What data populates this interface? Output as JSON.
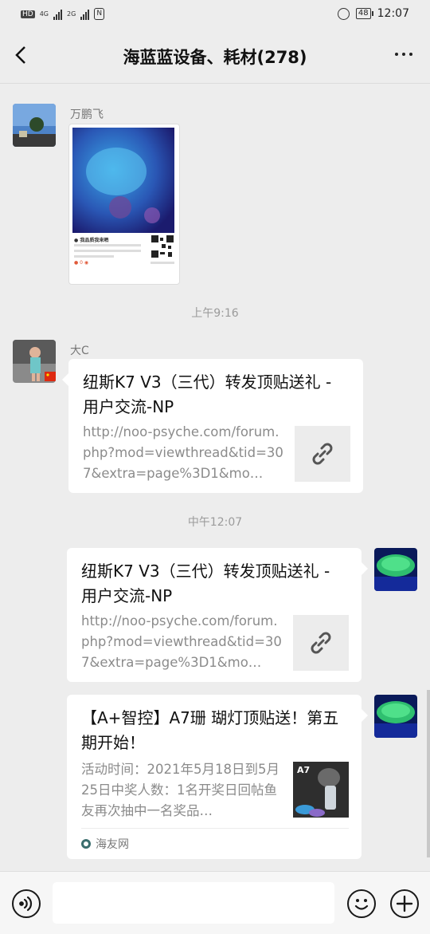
{
  "status_bar": {
    "left_badge": "HD",
    "sim1": "4G",
    "sim2": "2G",
    "battery": "48",
    "time": "12:07"
  },
  "header": {
    "title": "海蓝蓝设备、耗材(278)",
    "back_icon": "chevron-left-icon",
    "more_icon": "more-dots-icon"
  },
  "messages": [
    {
      "type": "image",
      "sender": "万鹏飞",
      "side": "left",
      "card_heading": "● 我品质我来晒",
      "card_tag": "● 0 ◉"
    },
    {
      "type": "time",
      "text": "上午9:16"
    },
    {
      "type": "link",
      "sender": "大C",
      "side": "left",
      "title": "纽斯K7 V3（三代）转发顶贴送礼 - 用户交流-NP",
      "desc": "http://noo-psyche.com/forum.php?mod=viewthread&tid=307&extra=page%3D1&mo…",
      "thumb_icon": "link-icon"
    },
    {
      "type": "time",
      "text": "中午12:07"
    },
    {
      "type": "link",
      "side": "right",
      "title": "纽斯K7 V3（三代）转发顶贴送礼 - 用户交流-NP",
      "desc": "http://noo-psyche.com/forum.php?mod=viewthread&tid=307&extra=page%3D1&mo…",
      "thumb_icon": "link-icon"
    },
    {
      "type": "article",
      "side": "right",
      "title": "【A+智控】A7珊 瑚灯顶贴送！第五期开始！",
      "desc": "活动时间：2021年5月18日到5月25日中奖人数：1名开奖日回帖鱼友再次抽中一名奖品…",
      "thumb_label": "A7",
      "source": "海友网"
    }
  ],
  "input_bar": {
    "voice_icon": "voice-icon",
    "placeholder": "",
    "emoji_icon": "emoji-icon",
    "add_icon": "add-icon"
  }
}
